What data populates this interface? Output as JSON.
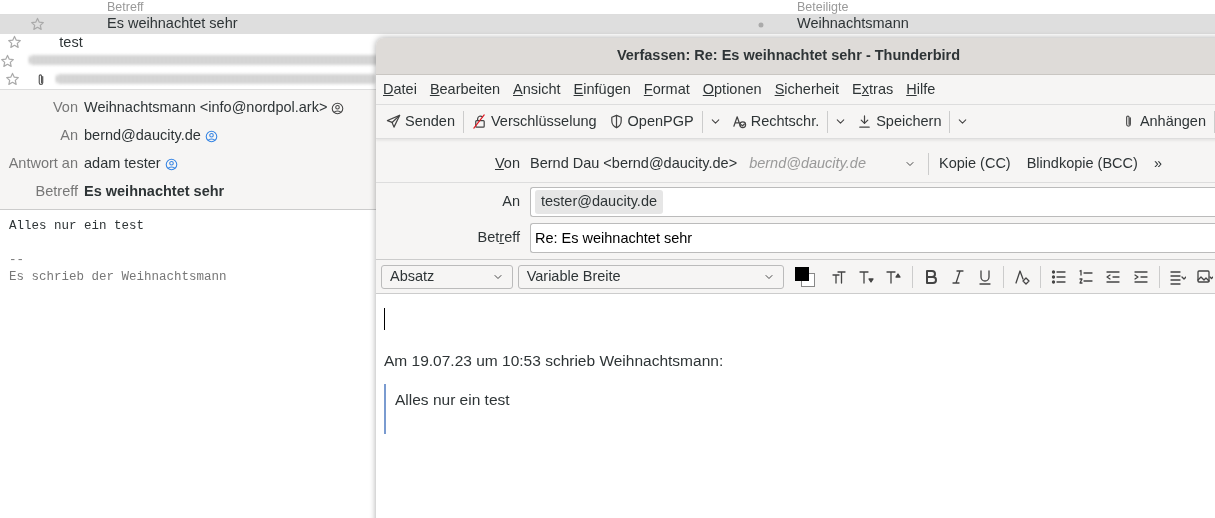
{
  "message_list": {
    "columns": [
      "Betreff",
      "Beteiligte"
    ],
    "rows": [
      {
        "subject": "Es weihnachtet sehr",
        "correspondent": "Weihnachtsmann",
        "selected": true,
        "attachment": false,
        "redacted": false
      },
      {
        "subject": "test",
        "selected": false,
        "attachment": false,
        "redacted": false
      },
      {
        "selected": false,
        "attachment": false,
        "redacted": true
      },
      {
        "selected": false,
        "attachment": true,
        "redacted": true
      }
    ]
  },
  "message_header": [
    {
      "label": "Von",
      "value": "Weihnachtsmann <info@nordpol.ark>",
      "kind": "contact",
      "in_address_book": false
    },
    {
      "label": "An",
      "value": "bernd@daucity.de",
      "kind": "contact",
      "in_address_book": true
    },
    {
      "label": "Antwort an",
      "value": "adam tester",
      "kind": "contact",
      "in_address_book": true
    },
    {
      "label": "Betreff",
      "value": "Es weihnachtet sehr",
      "kind": "subject"
    }
  ],
  "message_body": {
    "text": "Alles nur ein test",
    "signature_separator": "--",
    "signature": "Es schrieb der Weihnachtsmann"
  },
  "compose": {
    "title": "Verfassen: Re: Es weihnachtet sehr - Thunderbird",
    "menu": [
      {
        "key": "D",
        "post": "atei"
      },
      {
        "key": "B",
        "post": "earbeiten"
      },
      {
        "key": "A",
        "post": "nsicht"
      },
      {
        "key": "E",
        "post": "infügen"
      },
      {
        "key": "F",
        "post": "ormat"
      },
      {
        "key": "O",
        "post": "ptionen"
      },
      {
        "key": "S",
        "post": "icherheit"
      },
      {
        "pre": "E",
        "key": "x",
        "post": "tras"
      },
      {
        "key": "H",
        "post": "ilfe"
      }
    ],
    "toolbar": [
      {
        "label": "Senden",
        "kind": "send",
        "dropdown": false
      },
      {
        "label": "Verschlüsselung",
        "kind": "lock",
        "dropdown": false
      },
      {
        "label": "OpenPGP",
        "kind": "shield",
        "dropdown": true
      },
      {
        "label": "Rechtschr.",
        "kind": "spell",
        "dropdown": true
      },
      {
        "label": "Speichern",
        "kind": "save",
        "dropdown": true
      },
      {
        "label": "Anhängen",
        "kind": "clip",
        "dropdown": false
      }
    ],
    "from": {
      "label": {
        "key": "V",
        "post": "on"
      },
      "value": "Bernd Dau <bernd@daucity.de>",
      "hint": "bernd@daucity.de",
      "links": [
        "Kopie (CC)",
        "Blindkopie (BCC)"
      ],
      "more": "»"
    },
    "to": {
      "label": {
        "post": "An"
      },
      "recipients": [
        "tester@daucity.de"
      ]
    },
    "subject": {
      "label": {
        "pre": "Bet",
        "key": "r",
        "post": "eff"
      },
      "value": "Re: Es weihnachtet sehr"
    },
    "format": {
      "paragraph": "Absatz",
      "font": "Variable Breite"
    },
    "body": {
      "attribution": "Am 19.07.23 um 10:53 schrieb Weihnachtsmann:",
      "quote": "Alles nur ein test"
    }
  }
}
